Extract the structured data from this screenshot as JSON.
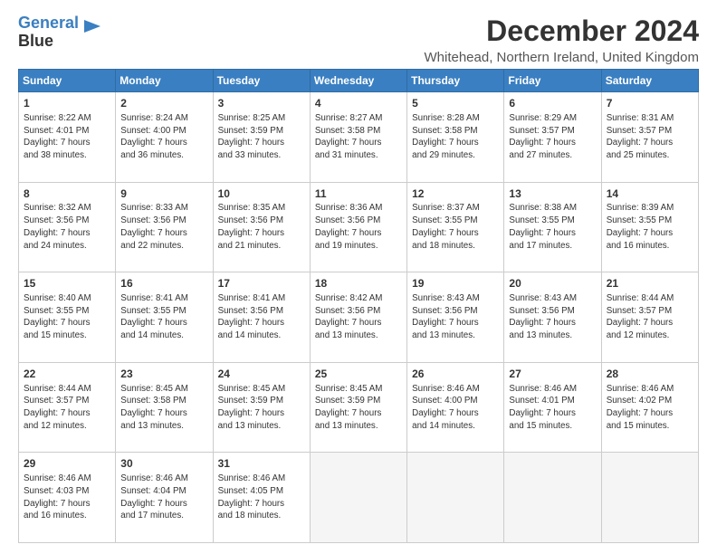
{
  "logo": {
    "line1": "General",
    "line2": "Blue"
  },
  "title": "December 2024",
  "subtitle": "Whitehead, Northern Ireland, United Kingdom",
  "days_of_week": [
    "Sunday",
    "Monday",
    "Tuesday",
    "Wednesday",
    "Thursday",
    "Friday",
    "Saturday"
  ],
  "weeks": [
    [
      {
        "day": "1",
        "info": "Sunrise: 8:22 AM\nSunset: 4:01 PM\nDaylight: 7 hours\nand 38 minutes."
      },
      {
        "day": "2",
        "info": "Sunrise: 8:24 AM\nSunset: 4:00 PM\nDaylight: 7 hours\nand 36 minutes."
      },
      {
        "day": "3",
        "info": "Sunrise: 8:25 AM\nSunset: 3:59 PM\nDaylight: 7 hours\nand 33 minutes."
      },
      {
        "day": "4",
        "info": "Sunrise: 8:27 AM\nSunset: 3:58 PM\nDaylight: 7 hours\nand 31 minutes."
      },
      {
        "day": "5",
        "info": "Sunrise: 8:28 AM\nSunset: 3:58 PM\nDaylight: 7 hours\nand 29 minutes."
      },
      {
        "day": "6",
        "info": "Sunrise: 8:29 AM\nSunset: 3:57 PM\nDaylight: 7 hours\nand 27 minutes."
      },
      {
        "day": "7",
        "info": "Sunrise: 8:31 AM\nSunset: 3:57 PM\nDaylight: 7 hours\nand 25 minutes."
      }
    ],
    [
      {
        "day": "8",
        "info": "Sunrise: 8:32 AM\nSunset: 3:56 PM\nDaylight: 7 hours\nand 24 minutes."
      },
      {
        "day": "9",
        "info": "Sunrise: 8:33 AM\nSunset: 3:56 PM\nDaylight: 7 hours\nand 22 minutes."
      },
      {
        "day": "10",
        "info": "Sunrise: 8:35 AM\nSunset: 3:56 PM\nDaylight: 7 hours\nand 21 minutes."
      },
      {
        "day": "11",
        "info": "Sunrise: 8:36 AM\nSunset: 3:56 PM\nDaylight: 7 hours\nand 19 minutes."
      },
      {
        "day": "12",
        "info": "Sunrise: 8:37 AM\nSunset: 3:55 PM\nDaylight: 7 hours\nand 18 minutes."
      },
      {
        "day": "13",
        "info": "Sunrise: 8:38 AM\nSunset: 3:55 PM\nDaylight: 7 hours\nand 17 minutes."
      },
      {
        "day": "14",
        "info": "Sunrise: 8:39 AM\nSunset: 3:55 PM\nDaylight: 7 hours\nand 16 minutes."
      }
    ],
    [
      {
        "day": "15",
        "info": "Sunrise: 8:40 AM\nSunset: 3:55 PM\nDaylight: 7 hours\nand 15 minutes."
      },
      {
        "day": "16",
        "info": "Sunrise: 8:41 AM\nSunset: 3:55 PM\nDaylight: 7 hours\nand 14 minutes."
      },
      {
        "day": "17",
        "info": "Sunrise: 8:41 AM\nSunset: 3:56 PM\nDaylight: 7 hours\nand 14 minutes."
      },
      {
        "day": "18",
        "info": "Sunrise: 8:42 AM\nSunset: 3:56 PM\nDaylight: 7 hours\nand 13 minutes."
      },
      {
        "day": "19",
        "info": "Sunrise: 8:43 AM\nSunset: 3:56 PM\nDaylight: 7 hours\nand 13 minutes."
      },
      {
        "day": "20",
        "info": "Sunrise: 8:43 AM\nSunset: 3:56 PM\nDaylight: 7 hours\nand 13 minutes."
      },
      {
        "day": "21",
        "info": "Sunrise: 8:44 AM\nSunset: 3:57 PM\nDaylight: 7 hours\nand 12 minutes."
      }
    ],
    [
      {
        "day": "22",
        "info": "Sunrise: 8:44 AM\nSunset: 3:57 PM\nDaylight: 7 hours\nand 12 minutes."
      },
      {
        "day": "23",
        "info": "Sunrise: 8:45 AM\nSunset: 3:58 PM\nDaylight: 7 hours\nand 13 minutes."
      },
      {
        "day": "24",
        "info": "Sunrise: 8:45 AM\nSunset: 3:59 PM\nDaylight: 7 hours\nand 13 minutes."
      },
      {
        "day": "25",
        "info": "Sunrise: 8:45 AM\nSunset: 3:59 PM\nDaylight: 7 hours\nand 13 minutes."
      },
      {
        "day": "26",
        "info": "Sunrise: 8:46 AM\nSunset: 4:00 PM\nDaylight: 7 hours\nand 14 minutes."
      },
      {
        "day": "27",
        "info": "Sunrise: 8:46 AM\nSunset: 4:01 PM\nDaylight: 7 hours\nand 15 minutes."
      },
      {
        "day": "28",
        "info": "Sunrise: 8:46 AM\nSunset: 4:02 PM\nDaylight: 7 hours\nand 15 minutes."
      }
    ],
    [
      {
        "day": "29",
        "info": "Sunrise: 8:46 AM\nSunset: 4:03 PM\nDaylight: 7 hours\nand 16 minutes."
      },
      {
        "day": "30",
        "info": "Sunrise: 8:46 AM\nSunset: 4:04 PM\nDaylight: 7 hours\nand 17 minutes."
      },
      {
        "day": "31",
        "info": "Sunrise: 8:46 AM\nSunset: 4:05 PM\nDaylight: 7 hours\nand 18 minutes."
      },
      {
        "day": "",
        "info": ""
      },
      {
        "day": "",
        "info": ""
      },
      {
        "day": "",
        "info": ""
      },
      {
        "day": "",
        "info": ""
      }
    ]
  ]
}
